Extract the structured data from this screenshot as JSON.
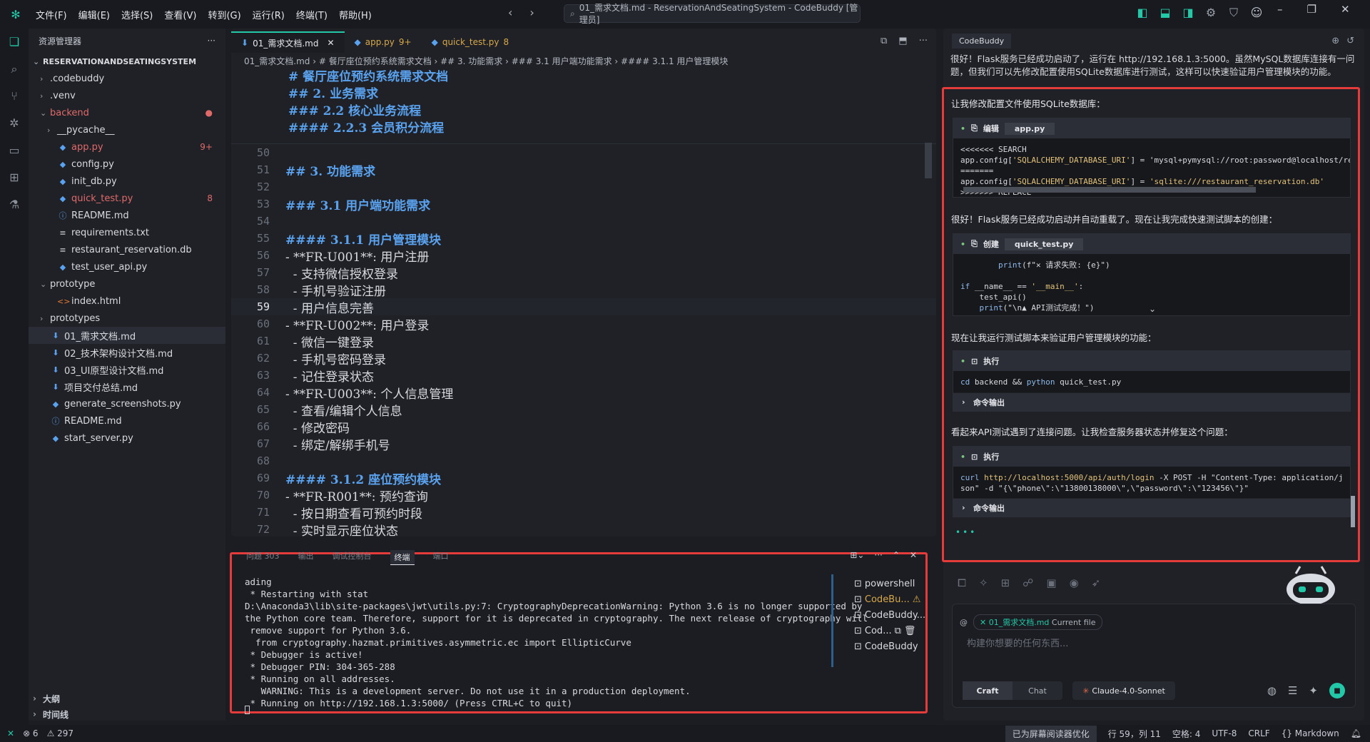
{
  "menu": [
    "文件(F)",
    "编辑(E)",
    "选择(S)",
    "查看(V)",
    "转到(G)",
    "运行(R)",
    "终端(T)",
    "帮助(H)"
  ],
  "window_title": "01_需求文档.md - ReservationAndSeatingSystem - CodeBuddy [管理员]",
  "explorer": {
    "title": "资源管理器",
    "root": "RESERVATIONANDSEATINGSYSTEM",
    "items": [
      {
        "label": ".codebuddy",
        "depth": 1,
        "kind": "folder-closed"
      },
      {
        "label": ".venv",
        "depth": 1,
        "kind": "folder-closed"
      },
      {
        "label": "backend",
        "depth": 1,
        "kind": "folder-open",
        "color": "#e06a6a",
        "badge": "●"
      },
      {
        "label": "__pycache__",
        "depth": 2,
        "kind": "folder-closed"
      },
      {
        "label": "app.py",
        "depth": 2,
        "kind": "py",
        "color": "#e06a6a",
        "badge": "9+"
      },
      {
        "label": "config.py",
        "depth": 2,
        "kind": "py"
      },
      {
        "label": "init_db.py",
        "depth": 2,
        "kind": "py"
      },
      {
        "label": "quick_test.py",
        "depth": 2,
        "kind": "py",
        "color": "#e06a6a",
        "badge": "8"
      },
      {
        "label": "README.md",
        "depth": 2,
        "kind": "info"
      },
      {
        "label": "requirements.txt",
        "depth": 2,
        "kind": "txt"
      },
      {
        "label": "restaurant_reservation.db",
        "depth": 2,
        "kind": "txt"
      },
      {
        "label": "test_user_api.py",
        "depth": 2,
        "kind": "py"
      },
      {
        "label": "prototype",
        "depth": 1,
        "kind": "folder-open"
      },
      {
        "label": "index.html",
        "depth": 2,
        "kind": "html"
      },
      {
        "label": "prototypes",
        "depth": 1,
        "kind": "folder-closed"
      },
      {
        "label": "01_需求文档.md",
        "depth": 1,
        "kind": "md",
        "selected": true
      },
      {
        "label": "02_技术架构设计文档.md",
        "depth": 1,
        "kind": "md"
      },
      {
        "label": "03_UI原型设计文档.md",
        "depth": 1,
        "kind": "md"
      },
      {
        "label": "项目交付总结.md",
        "depth": 1,
        "kind": "md"
      },
      {
        "label": "generate_screenshots.py",
        "depth": 1,
        "kind": "py"
      },
      {
        "label": "README.md",
        "depth": 1,
        "kind": "info"
      },
      {
        "label": "start_server.py",
        "depth": 1,
        "kind": "py"
      }
    ],
    "outline": "大纲",
    "timeline": "时间线"
  },
  "tabs": [
    {
      "label": "01_需求文档.md",
      "active": true
    },
    {
      "label": "app.py",
      "count": "9+"
    },
    {
      "label": "quick_test.py",
      "count": "8"
    }
  ],
  "breadcrumb": "01_需求文档.md  ›  # 餐厅座位预约系统需求文档  ›  ## 3. 功能需求  ›  ### 3.1 用户端功能需求  ›  #### 3.1.1 用户管理模块",
  "sticky": [
    "# 餐厅座位预约系统需求文档",
    "## 2. 业务需求",
    "### 2.2 核心业务流程",
    "#### 2.2.3 会员积分流程"
  ],
  "code_lines": [
    {
      "n": "50",
      "t": ""
    },
    {
      "n": "51",
      "t": "## 3. 功能需求",
      "h": true
    },
    {
      "n": "52",
      "t": ""
    },
    {
      "n": "53",
      "t": "### 3.1 用户端功能需求",
      "h": true
    },
    {
      "n": "54",
      "t": ""
    },
    {
      "n": "55",
      "t": "#### 3.1.1 用户管理模块",
      "h": true
    },
    {
      "n": "56",
      "t": "- **FR-U001**: 用户注册"
    },
    {
      "n": "57",
      "t": "  - 支持微信授权登录"
    },
    {
      "n": "58",
      "t": "  - 手机号验证注册"
    },
    {
      "n": "59",
      "t": "  - 用户信息完善",
      "cur": true
    },
    {
      "n": "60",
      "t": "- **FR-U002**: 用户登录"
    },
    {
      "n": "61",
      "t": "  - 微信一键登录"
    },
    {
      "n": "62",
      "t": "  - 手机号密码登录"
    },
    {
      "n": "63",
      "t": "  - 记住登录状态"
    },
    {
      "n": "64",
      "t": "- **FR-U003**: 个人信息管理"
    },
    {
      "n": "65",
      "t": "  - 查看/编辑个人信息"
    },
    {
      "n": "66",
      "t": "  - 修改密码"
    },
    {
      "n": "67",
      "t": "  - 绑定/解绑手机号"
    },
    {
      "n": "68",
      "t": ""
    },
    {
      "n": "69",
      "t": "#### 3.1.2 座位预约模块",
      "h": true
    },
    {
      "n": "70",
      "t": "- **FR-R001**: 预约查询"
    },
    {
      "n": "71",
      "t": "  - 按日期查看可预约时段"
    },
    {
      "n": "72",
      "t": "  - 实时显示座位状态"
    }
  ],
  "terminal": {
    "tabs": [
      "问题 303",
      "输出",
      "调试控制台",
      "终端",
      "端口"
    ],
    "active_tab": "终端",
    "output": "ading\n * Restarting with stat\nD:\\Anaconda3\\lib\\site-packages\\jwt\\utils.py:7: CryptographyDeprecationWarning: Python 3.6 is no longer supported by\nthe Python core team. Therefore, support for it is deprecated in cryptography. The next release of cryptography will\n remove support for Python 3.6.\n  from cryptography.hazmat.primitives.asymmetric.ec import EllipticCurve\n * Debugger is active!\n * Debugger PIN: 304-365-288\n * Running on all addresses.\n   WARNING: This is a development server. Do not use it in a production deployment.\n * Running on http://192.168.1.3:5000/ (Press CTRL+C to quit)",
    "sessions": [
      "powershell",
      "CodeBu...",
      "CodeBuddy...",
      "Cod...",
      "CodeBuddy"
    ]
  },
  "chat": {
    "panel_title": "CodeBuddy",
    "intro": "很好！Flask服务已经成功启动了，运行在 http://192.168.1.3:5000。虽然MySQL数据库连接有一问题，但我们可以先修改配置使用SQLite数据库进行测试，这样可以快速验证用户管理模块的功能。",
    "msg1": "让我修改配置文件使用SQLite数据库：",
    "card1_action": "编辑",
    "card1_file": "app.py",
    "card1_code": "<<<<<<< SEARCH\napp.config['SQLALCHEMY_DATABASE_URI'] = 'mysql+pymysql://root:password@localhost/re\n=======\napp.config['SQLALCHEMY_DATABASE_URI'] = 'sqlite:///restaurant_reservation.db'\n>>>>>>> REPLACE",
    "msg2": "很好！Flask服务已经成功启动并自动重载了。现在让我完成快速测试脚本的创建：",
    "card2_action": "创建",
    "card2_file": "quick_test.py",
    "card2_code": "        print(f\"✕ 请求失败: {e}\")\n\nif __name__ == '__main__':\n    test_api()\n    print(\"\\n▲ API测试完成！\")",
    "msg3": "现在让我运行测试脚本来验证用户管理模块的功能：",
    "card3_action": "执行",
    "card3_code": "cd backend && python quick_test.py",
    "output_label": "命令输出",
    "msg4": "看起来API测试遇到了连接问题。让我检查服务器状态并修复这个问题：",
    "card4_action": "执行",
    "card4_code": "curl http://localhost:5000/api/auth/login -X POST -H \"Content-Type: application/j\nson\" -d \"{\\\"phone\\\":\\\"13800138000\\\",\\\"password\\\":\\\"123456\\\"}\"",
    "input": {
      "at": "@",
      "ctx_file": "01_需求文档.md",
      "ctx_suffix": "Current file",
      "placeholder": "构建你想要的任何东西...",
      "mode_craft": "Craft",
      "mode_chat": "Chat",
      "model": "Claude-4.0-Sonnet"
    }
  },
  "status": {
    "errors": "⊗ 6",
    "warnings": "⚠ 297",
    "reader": "已为屏幕阅读器优化",
    "position": "行 59，列 11",
    "spaces": "空格: 4",
    "encoding": "UTF-8",
    "eol": "CRLF",
    "lang": "{} Markdown"
  },
  "colors": {
    "accent": "#23c8a8",
    "highlight_border": "#e53b3b",
    "heading": "#5aa2ee",
    "warn": "#d7a84a"
  }
}
